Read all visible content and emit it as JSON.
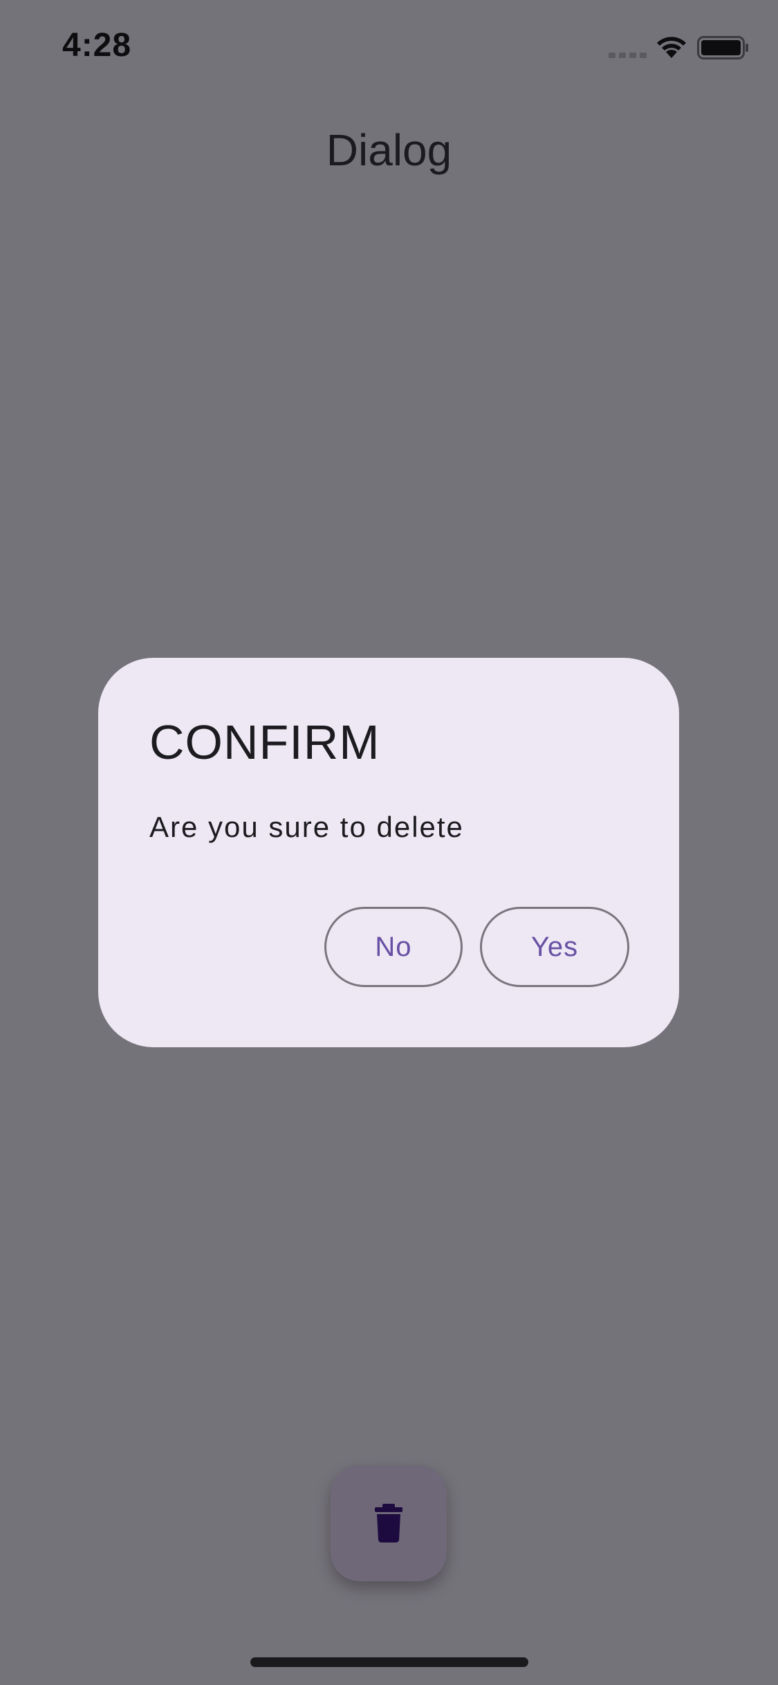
{
  "status_bar": {
    "time": "4:28",
    "icons": [
      "cellular-signal-icon",
      "wifi-icon",
      "battery-icon"
    ]
  },
  "app_bar": {
    "title": "Dialog"
  },
  "dialog": {
    "title": "CONFIRM",
    "message": "Are you sure to delete",
    "buttons": {
      "no_label": "No",
      "yes_label": "Yes"
    }
  },
  "fab": {
    "icon": "trash-icon"
  },
  "colors": {
    "scrim_background": "#75737a",
    "dialog_surface": "#eee8f4",
    "button_text": "#6750a4",
    "button_outline": "#79747e",
    "fab_background": "#6e6878",
    "fab_icon": "#1d0b3f"
  }
}
